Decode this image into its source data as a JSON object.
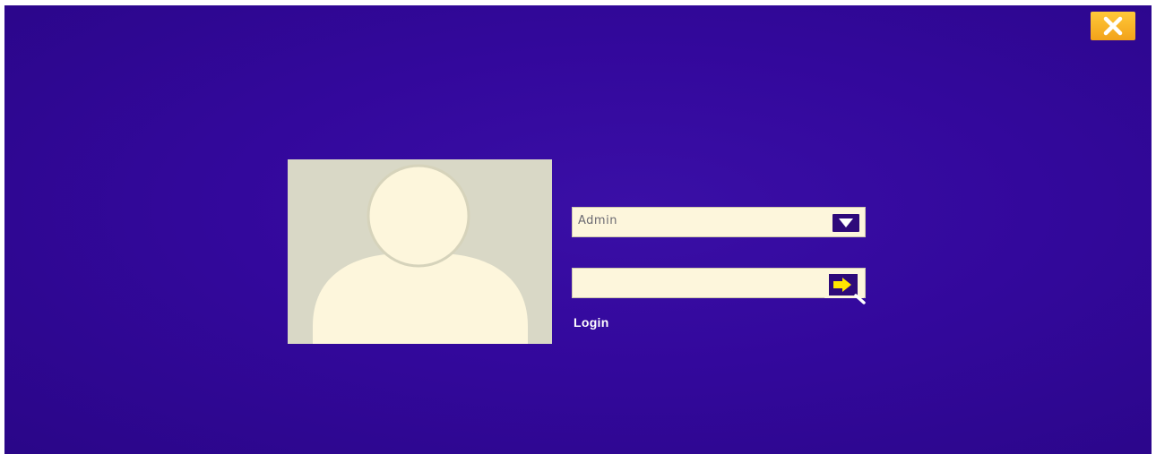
{
  "login_screen": {
    "close_icon": "close-icon",
    "avatar_icon": "user-silhouette-icon",
    "user_select": {
      "selected_value": "Admin",
      "dropdown_icon": "chevron-down-icon"
    },
    "password": {
      "value": "",
      "placeholder": ""
    },
    "submit_icon": "arrow-right-icon",
    "login_label": "Login"
  },
  "colors": {
    "background": "#33089c",
    "close_button": "#f7b12a",
    "avatar_panel": "#d9d8c6",
    "avatar_figure": "#fdf6dc",
    "field_background": "#fdf6dc",
    "button_dark": "#2e0a7a",
    "arrow_yellow": "#ffe600",
    "label_text": "#ffffff"
  }
}
